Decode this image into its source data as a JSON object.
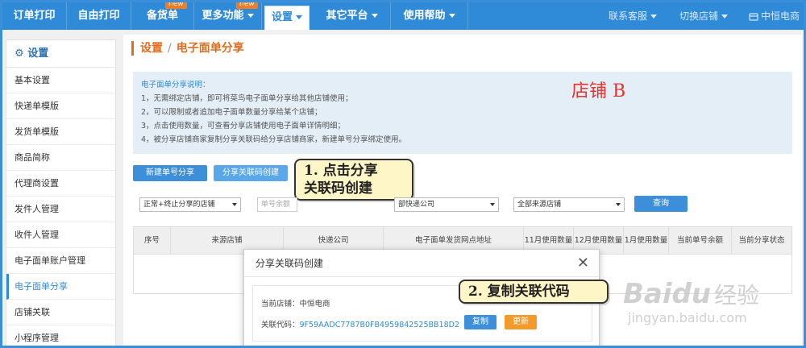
{
  "topnav": {
    "items": [
      {
        "label": "订单打印"
      },
      {
        "label": "自由打印"
      },
      {
        "label": "备货单",
        "badge": "new"
      },
      {
        "label": "更多功能",
        "badge": "new"
      },
      {
        "label": "设置"
      },
      {
        "label": "其它平台"
      },
      {
        "label": "使用帮助"
      }
    ],
    "right": {
      "service": "联系客服",
      "switch_shop": "切换店铺",
      "shop_name": "中恒电商"
    }
  },
  "sidebar": {
    "title": "设置",
    "items": [
      {
        "label": "基本设置"
      },
      {
        "label": "快递单模版"
      },
      {
        "label": "发货单模版"
      },
      {
        "label": "商品简称"
      },
      {
        "label": "代理商设置"
      },
      {
        "label": "发件人管理"
      },
      {
        "label": "收件人管理"
      },
      {
        "label": "电子面单账户管理"
      },
      {
        "label": "电子面单分享",
        "active": true
      },
      {
        "label": "店铺关联"
      },
      {
        "label": "小程序管理"
      }
    ]
  },
  "breadcrumb": {
    "root": "设置",
    "sep": "/",
    "current": "电子面单分享"
  },
  "notice": {
    "title": "电子面单分享说明：",
    "lines": [
      "1，无需绑定店铺，即可将菜鸟电子面单分享给其他店铺使用；",
      "2，可以限制或者追加电子面单数量分享给某个店铺；",
      "3，点击使用数量，可查看分享店铺使用电子面单详情明细；",
      "4，被分享店铺商家复制分享关联码给分享店铺商家，新建单号分享绑定使用。"
    ]
  },
  "shop_tag": "店铺 B",
  "actions": {
    "new_share": "新建单号分享",
    "create_code": "分享关联码创建"
  },
  "callouts": {
    "step1_line1": "1. 点击分享",
    "step1_line2": "关联码创建",
    "step2": "2. 复制关联代码"
  },
  "filters": {
    "status": "正常+终止分享的店铺",
    "remaining_placeholder": "单号余额",
    "express": "部快递公司",
    "source_shop": "全部来源店铺",
    "query": "查询"
  },
  "table": {
    "headers": [
      "序号",
      "来源店铺",
      "快递公司",
      "电子面单发货网点地址",
      "11月使用数量",
      "12月使用数量",
      "1月使用数量",
      "当前单号余额",
      "当前分享状态"
    ]
  },
  "dialog": {
    "title": "分享关联码创建",
    "close": "✕",
    "shop_label": "当前店铺：",
    "shop_value": "中恒电商",
    "code_label": "关联代码：",
    "code_value": "9F59AADC7787B0FB4959842525BB18D2",
    "copy": "复制",
    "refresh": "更新"
  },
  "watermark": {
    "brand": "Baidu",
    "sub": "经验",
    "url": "jingyan.baidu.com"
  }
}
